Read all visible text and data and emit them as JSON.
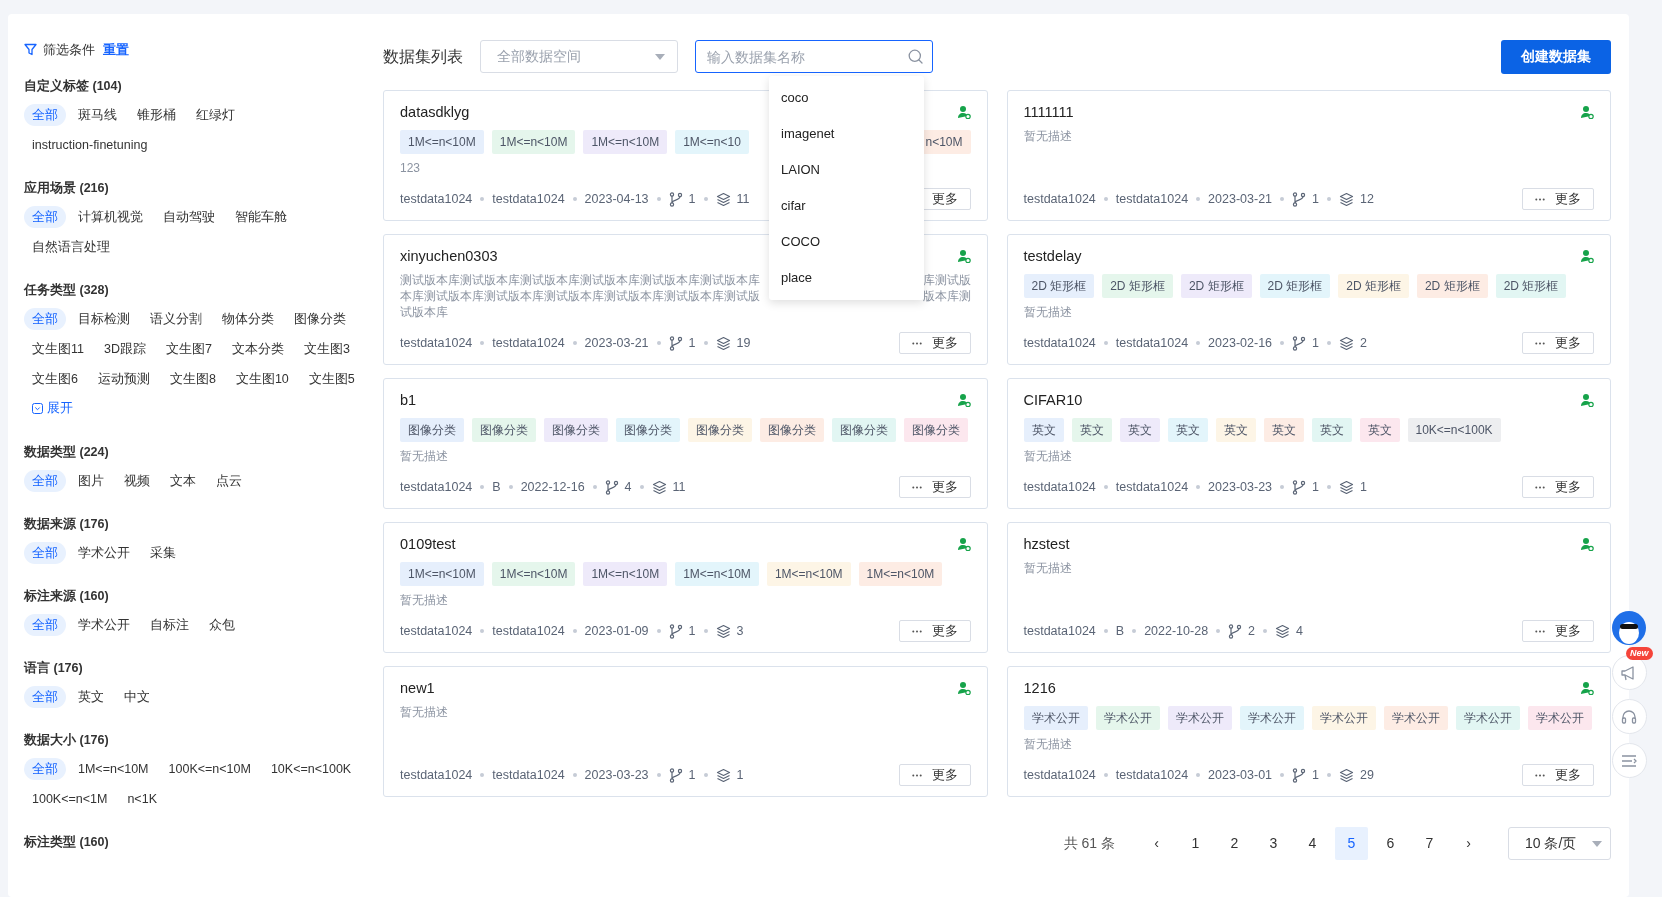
{
  "filters": {
    "title": "筛选条件",
    "reset": "重置"
  },
  "filter_groups": [
    {
      "title": "自定义标签 (104)",
      "options": [
        {
          "label": "全部",
          "selected": true
        },
        {
          "label": "斑马线",
          "selected": false
        },
        {
          "label": "锥形桶",
          "selected": false
        },
        {
          "label": "红绿灯",
          "selected": false
        },
        {
          "label": "instruction-finetuning",
          "selected": false
        }
      ]
    },
    {
      "title": "应用场景 (216)",
      "options": [
        {
          "label": "全部",
          "selected": true
        },
        {
          "label": "计算机视觉",
          "selected": false
        },
        {
          "label": "自动驾驶",
          "selected": false
        },
        {
          "label": "智能车舱",
          "selected": false
        },
        {
          "label": "自然语言处理",
          "selected": false
        }
      ]
    },
    {
      "title": "任务类型 (328)",
      "options": [
        {
          "label": "全部",
          "selected": true
        },
        {
          "label": "目标检测",
          "selected": false
        },
        {
          "label": "语义分割",
          "selected": false
        },
        {
          "label": "物体分类",
          "selected": false
        },
        {
          "label": "图像分类",
          "selected": false
        },
        {
          "label": "文生图11",
          "selected": false
        },
        {
          "label": "3D跟踪",
          "selected": false
        },
        {
          "label": "文生图7",
          "selected": false
        },
        {
          "label": "文本分类",
          "selected": false
        },
        {
          "label": "文生图3",
          "selected": false
        },
        {
          "label": "文生图6",
          "selected": false
        },
        {
          "label": "运动预测",
          "selected": false
        },
        {
          "label": "文生图8",
          "selected": false
        },
        {
          "label": "文生图10",
          "selected": false
        },
        {
          "label": "文生图5",
          "selected": false
        }
      ],
      "expand": "展开"
    },
    {
      "title": "数据类型 (224)",
      "options": [
        {
          "label": "全部",
          "selected": true
        },
        {
          "label": "图片",
          "selected": false
        },
        {
          "label": "视频",
          "selected": false
        },
        {
          "label": "文本",
          "selected": false
        },
        {
          "label": "点云",
          "selected": false
        }
      ]
    },
    {
      "title": "数据来源 (176)",
      "options": [
        {
          "label": "全部",
          "selected": true
        },
        {
          "label": "学术公开",
          "selected": false
        },
        {
          "label": "采集",
          "selected": false
        }
      ]
    },
    {
      "title": "标注来源 (160)",
      "options": [
        {
          "label": "全部",
          "selected": true
        },
        {
          "label": "学术公开",
          "selected": false
        },
        {
          "label": "自标注",
          "selected": false
        },
        {
          "label": "众包",
          "selected": false
        }
      ]
    },
    {
      "title": "语言 (176)",
      "options": [
        {
          "label": "全部",
          "selected": true
        },
        {
          "label": "英文",
          "selected": false
        },
        {
          "label": "中文",
          "selected": false
        }
      ]
    },
    {
      "title": "数据大小 (176)",
      "options": [
        {
          "label": "全部",
          "selected": true
        },
        {
          "label": "1M<=n<10M",
          "selected": false
        },
        {
          "label": "100K<=n<10M",
          "selected": false
        },
        {
          "label": "10K<=n<100K",
          "selected": false
        },
        {
          "label": "100K<=n<1M",
          "selected": false
        },
        {
          "label": "n<1K",
          "selected": false
        }
      ]
    },
    {
      "title": "标注类型 (160)"
    }
  ],
  "header": {
    "title": "数据集列表",
    "space_select": {
      "placeholder": "全部数据空间"
    },
    "search": {
      "placeholder": "输入数据集名称"
    },
    "create_button": "创建数据集"
  },
  "search_suggestions": [
    "coco",
    "imagenet",
    "LAION",
    "cifar",
    "COCO",
    "place"
  ],
  "datasets": [
    {
      "name": "datasdklyg",
      "tags": [
        {
          "label": "1M<=n<10M",
          "color": "#e6effc"
        },
        {
          "label": "1M<=n<10M",
          "color": "#e5f6ec"
        },
        {
          "label": "1M<=n<10M",
          "color": "#eeeafa"
        },
        {
          "label": "1M<=n<10",
          "color": "#e3f5fb"
        }
      ],
      "tail_tags": [
        {
          "label": "n<10M",
          "color": "#fdece4"
        }
      ],
      "description": "123",
      "meta": [
        "testdata1024",
        "testdata1024",
        "2023-04-13"
      ],
      "branches": "1",
      "versions": "11",
      "more": "更多"
    },
    {
      "name": "1111111",
      "description": "暂无描述",
      "meta": [
        "testdata1024",
        "testdata1024",
        "2023-03-21"
      ],
      "branches": "1",
      "versions": "12",
      "more": "更多"
    },
    {
      "name": "xinyuchen0303",
      "description_lines": [
        {
          "left": "测试版本库测试版本库测试版本库测试版本库测试版本库测试版本库",
          "right": "库测试版"
        },
        {
          "left": "本库测试版本库测试版本库测试版本库测试版本库测试版本库测试版",
          "right": "版本库测"
        },
        {
          "left": "试版本库"
        }
      ],
      "meta": [
        "testdata1024",
        "testdata1024",
        "2023-03-21"
      ],
      "branches": "1",
      "versions": "19",
      "more": "更多"
    },
    {
      "name": "testdelay",
      "tags": [
        {
          "label": "2D 矩形框",
          "color": "#e6effc"
        },
        {
          "label": "2D 矩形框",
          "color": "#e5f6ec"
        },
        {
          "label": "2D 矩形框",
          "color": "#eeeafa"
        },
        {
          "label": "2D 矩形框",
          "color": "#e3f5fb"
        },
        {
          "label": "2D 矩形框",
          "color": "#fdf5e6"
        },
        {
          "label": "2D 矩形框",
          "color": "#fdece4"
        },
        {
          "label": "2D 矩形框",
          "color": "#e2f6f3"
        }
      ],
      "description": "暂无描述",
      "meta": [
        "testdata1024",
        "testdata1024",
        "2023-02-16"
      ],
      "branches": "1",
      "versions": "2",
      "more": "更多"
    },
    {
      "name": "b1",
      "tags": [
        {
          "label": "图像分类",
          "color": "#e6effc"
        },
        {
          "label": "图像分类",
          "color": "#e5f6ec"
        },
        {
          "label": "图像分类",
          "color": "#eeeafa"
        },
        {
          "label": "图像分类",
          "color": "#e3f5fb"
        },
        {
          "label": "图像分类",
          "color": "#fdf5e6"
        },
        {
          "label": "图像分类",
          "color": "#fdece4"
        },
        {
          "label": "图像分类",
          "color": "#e2f6f3"
        },
        {
          "label": "图像分类",
          "color": "#fce7ee"
        }
      ],
      "description": "暂无描述",
      "meta": [
        "testdata1024",
        "B",
        "2022-12-16"
      ],
      "branches": "4",
      "versions": "11",
      "more": "更多"
    },
    {
      "name": "CIFAR10",
      "tags": [
        {
          "label": "英文",
          "color": "#e6effc"
        },
        {
          "label": "英文",
          "color": "#e5f6ec"
        },
        {
          "label": "英文",
          "color": "#eeeafa"
        },
        {
          "label": "英文",
          "color": "#e3f5fb"
        },
        {
          "label": "英文",
          "color": "#fdf5e6"
        },
        {
          "label": "英文",
          "color": "#fdece4"
        },
        {
          "label": "英文",
          "color": "#e2f6f3"
        },
        {
          "label": "英文",
          "color": "#fce7ee"
        },
        {
          "label": "10K<=n<100K",
          "color": "#edeef0"
        }
      ],
      "description": "暂无描述",
      "meta": [
        "testdata1024",
        "testdata1024",
        "2023-03-23"
      ],
      "branches": "1",
      "versions": "1",
      "more": "更多"
    },
    {
      "name": "0109test",
      "tags": [
        {
          "label": "1M<=n<10M",
          "color": "#e6effc"
        },
        {
          "label": "1M<=n<10M",
          "color": "#e5f6ec"
        },
        {
          "label": "1M<=n<10M",
          "color": "#eeeafa"
        },
        {
          "label": "1M<=n<10M",
          "color": "#e3f5fb"
        },
        {
          "label": "1M<=n<10M",
          "color": "#fdf5e6"
        },
        {
          "label": "1M<=n<10M",
          "color": "#fdece4"
        }
      ],
      "description": "暂无描述",
      "meta": [
        "testdata1024",
        "testdata1024",
        "2023-01-09"
      ],
      "branches": "1",
      "versions": "3",
      "more": "更多"
    },
    {
      "name": "hzstest",
      "description": "暂无描述",
      "meta": [
        "testdata1024",
        "B",
        "2022-10-28"
      ],
      "branches": "2",
      "versions": "4",
      "more": "更多"
    },
    {
      "name": "new1",
      "description": "暂无描述",
      "meta": [
        "testdata1024",
        "testdata1024",
        "2023-03-23"
      ],
      "branches": "1",
      "versions": "1",
      "more": "更多"
    },
    {
      "name": "1216",
      "tags": [
        {
          "label": "学术公开",
          "color": "#e6effc"
        },
        {
          "label": "学术公开",
          "color": "#e5f6ec"
        },
        {
          "label": "学术公开",
          "color": "#eeeafa"
        },
        {
          "label": "学术公开",
          "color": "#e3f5fb"
        },
        {
          "label": "学术公开",
          "color": "#fdf5e6"
        },
        {
          "label": "学术公开",
          "color": "#fdece4"
        },
        {
          "label": "学术公开",
          "color": "#e2f6f3"
        },
        {
          "label": "学术公开",
          "color": "#fce7ee"
        }
      ],
      "description": "暂无描述",
      "meta": [
        "testdata1024",
        "testdata1024",
        "2023-03-01"
      ],
      "branches": "1",
      "versions": "29",
      "more": "更多"
    }
  ],
  "pagination": {
    "total": "共 61 条",
    "prev": "‹",
    "next": "›",
    "pages": [
      {
        "label": "1",
        "selected": false
      },
      {
        "label": "2",
        "selected": false
      },
      {
        "label": "3",
        "selected": false
      },
      {
        "label": "4",
        "selected": false
      },
      {
        "label": "5",
        "selected": true
      },
      {
        "label": "6",
        "selected": false
      },
      {
        "label": "7",
        "selected": false
      }
    ],
    "page_size": "10 条/页"
  },
  "float_tools": {
    "new_badge": "New"
  }
}
